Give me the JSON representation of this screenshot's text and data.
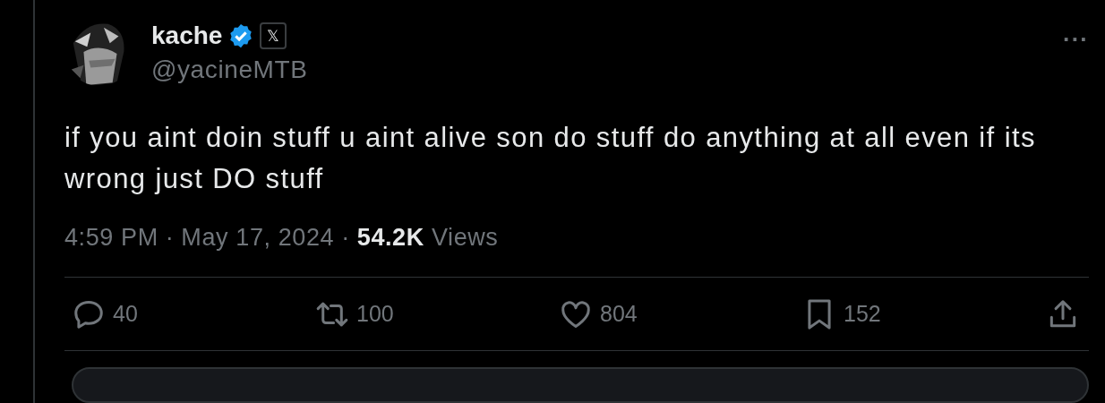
{
  "author": {
    "name": "kache",
    "verified": true,
    "affiliate_badge": "𝕏",
    "handle": "@yacineMTB"
  },
  "more_button": "···",
  "text": "if you aint doin stuff u aint alive son do stuff do anything at all even if its wrong just DO stuff",
  "meta": {
    "time": "4:59 PM",
    "separator_1": "·",
    "date": "May 17, 2024",
    "separator_2": "·",
    "views_count": "54.2K",
    "views_label": "Views"
  },
  "actions": [
    {
      "kind": "reply",
      "count": "40"
    },
    {
      "kind": "repost",
      "count": "100"
    },
    {
      "kind": "like",
      "count": "804"
    },
    {
      "kind": "bookmark",
      "count": "152"
    },
    {
      "kind": "share"
    }
  ]
}
